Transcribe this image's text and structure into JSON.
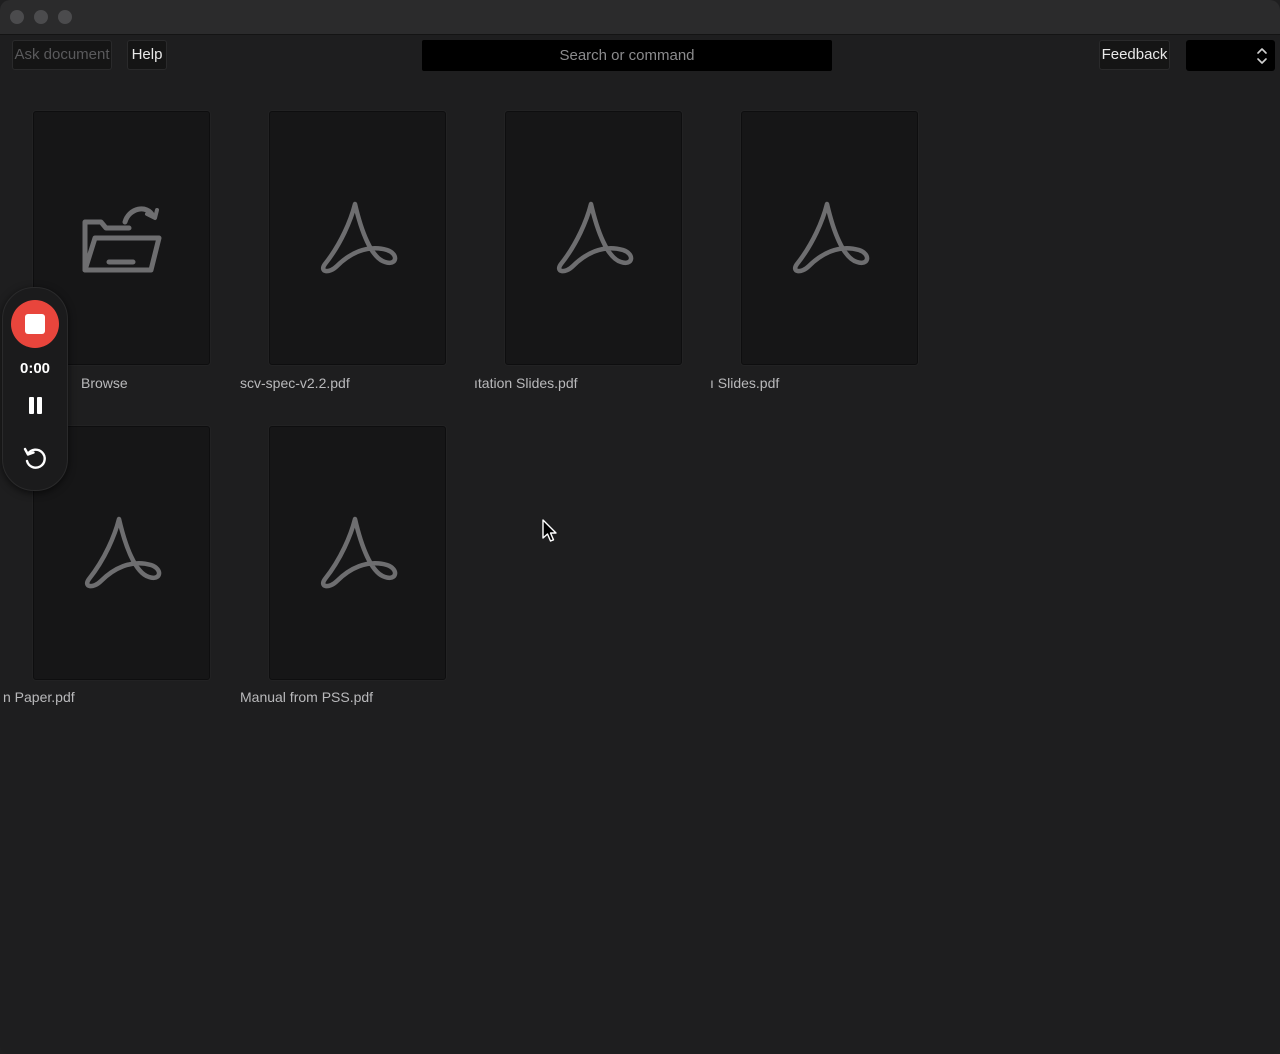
{
  "toolbar": {
    "ask_document_label": "Ask document",
    "help_label": "Help",
    "search_placeholder": "Search or command",
    "feedback_label": "Feedback",
    "select_value": ""
  },
  "documents": [
    {
      "label": "Browse",
      "icon": "folder-open-icon"
    },
    {
      "label": "scv-spec-v2.2.pdf",
      "icon": "pdf-icon"
    },
    {
      "label": "ıtation Slides.pdf",
      "icon": "pdf-icon"
    },
    {
      "label": "ı Slides.pdf",
      "icon": "pdf-icon"
    },
    {
      "label": "n Paper.pdf",
      "icon": "pdf-icon"
    },
    {
      "label": "Manual from PSS.pdf",
      "icon": "pdf-icon"
    }
  ],
  "recorder": {
    "time": "0:00",
    "stop_icon": "stop-icon",
    "pause_icon": "pause-icon",
    "restart_icon": "restart-icon",
    "accent": "#e8453c"
  },
  "colors": {
    "background": "#1e1e1f",
    "card": "#161617",
    "icon": "#6e6e70",
    "record": "#e8453c"
  }
}
